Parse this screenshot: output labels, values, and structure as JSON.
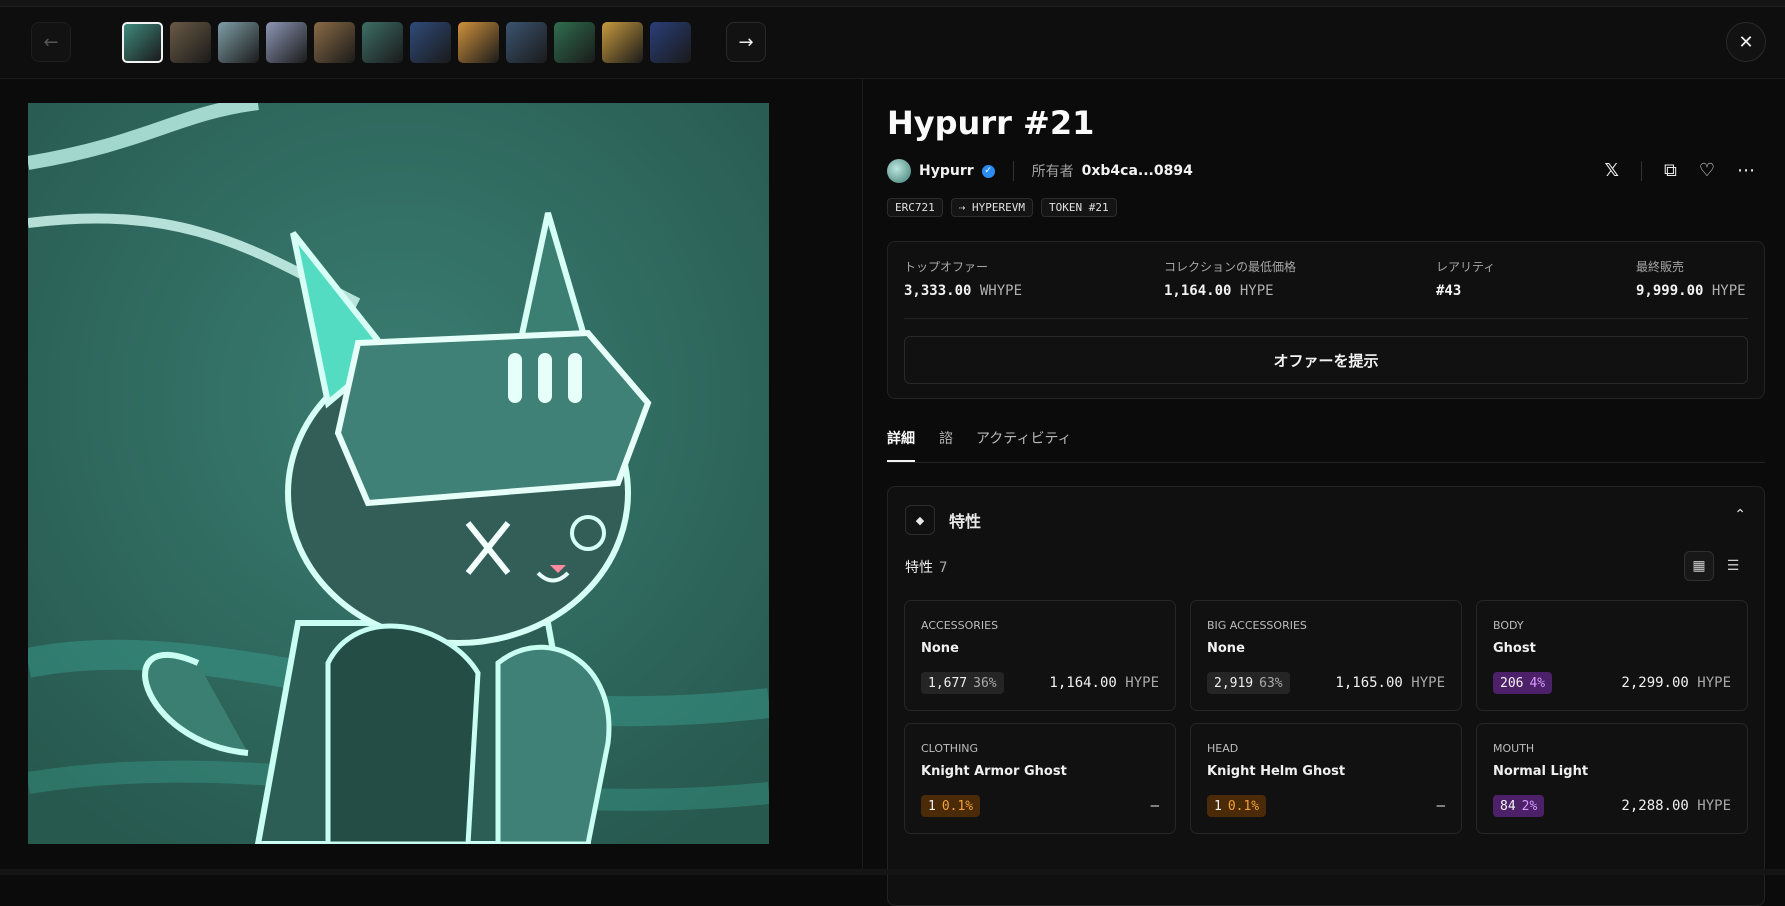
{
  "nav": {
    "prev_icon": "arrow-left-icon",
    "next_icon": "arrow-right-icon",
    "close_icon": "close-icon",
    "thumbnails": [
      {
        "color": "#3f8a7e",
        "active": true
      },
      {
        "color": "#6b5a45",
        "active": false
      },
      {
        "color": "#7f9ea8",
        "active": false
      },
      {
        "color": "#8c97b5",
        "active": false
      },
      {
        "color": "#8a6b45",
        "active": false
      },
      {
        "color": "#3d6e66",
        "active": false
      },
      {
        "color": "#2f4b7a",
        "active": false
      },
      {
        "color": "#d0913c",
        "active": false
      },
      {
        "color": "#3b5470",
        "active": false
      },
      {
        "color": "#2f6e4f",
        "active": false
      },
      {
        "color": "#c79a3e",
        "active": false
      },
      {
        "color": "#2a3e78",
        "active": false
      }
    ]
  },
  "item": {
    "title": "Hypurr #21",
    "collection": "Hypurr",
    "owner_label": "所有者",
    "owner": "0xb4ca...0894",
    "tags": [
      "ERC721",
      "⇢ HYPEREVM",
      "TOKEN #21"
    ]
  },
  "actions": {
    "x_icon": "x-logo-icon",
    "copy_icon": "copy-icon",
    "heart_icon": "heart-icon",
    "more_icon": "more-icon"
  },
  "stats": [
    {
      "label": "トップオファー",
      "value": "3,333.00",
      "unit": "WHYPE"
    },
    {
      "label": "コレクションの最低価格",
      "value": "1,164.00",
      "unit": "HYPE"
    },
    {
      "label": "レアリティ",
      "value": "#43",
      "unit": ""
    },
    {
      "label": "最終販売",
      "value": "9,999.00",
      "unit": "HYPE"
    }
  ],
  "offer_button": "オファーを提示",
  "tabs": [
    "詳細",
    "諮",
    "アクティビティ"
  ],
  "traits": {
    "heading": "特性",
    "sub_label": "特性",
    "count": "7",
    "items": [
      {
        "type": "ACCESSORIES",
        "value": "None",
        "count": "1,677",
        "pct": "36%",
        "style": "gray",
        "price": "1,164.00",
        "unit": "HYPE"
      },
      {
        "type": "BIG ACCESSORIES",
        "value": "None",
        "count": "2,919",
        "pct": "63%",
        "style": "gray",
        "price": "1,165.00",
        "unit": "HYPE"
      },
      {
        "type": "BODY",
        "value": "Ghost",
        "count": "206",
        "pct": "4%",
        "style": "purple",
        "price": "2,299.00",
        "unit": "HYPE"
      },
      {
        "type": "CLOTHING",
        "value": "Knight Armor Ghost",
        "count": "1",
        "pct": "0.1%",
        "style": "orange",
        "price": "—",
        "unit": ""
      },
      {
        "type": "HEAD",
        "value": "Knight Helm Ghost",
        "count": "1",
        "pct": "0.1%",
        "style": "orange",
        "price": "—",
        "unit": ""
      },
      {
        "type": "MOUTH",
        "value": "Normal Light",
        "count": "84",
        "pct": "2%",
        "style": "purple",
        "price": "2,288.00",
        "unit": "HYPE"
      }
    ]
  }
}
